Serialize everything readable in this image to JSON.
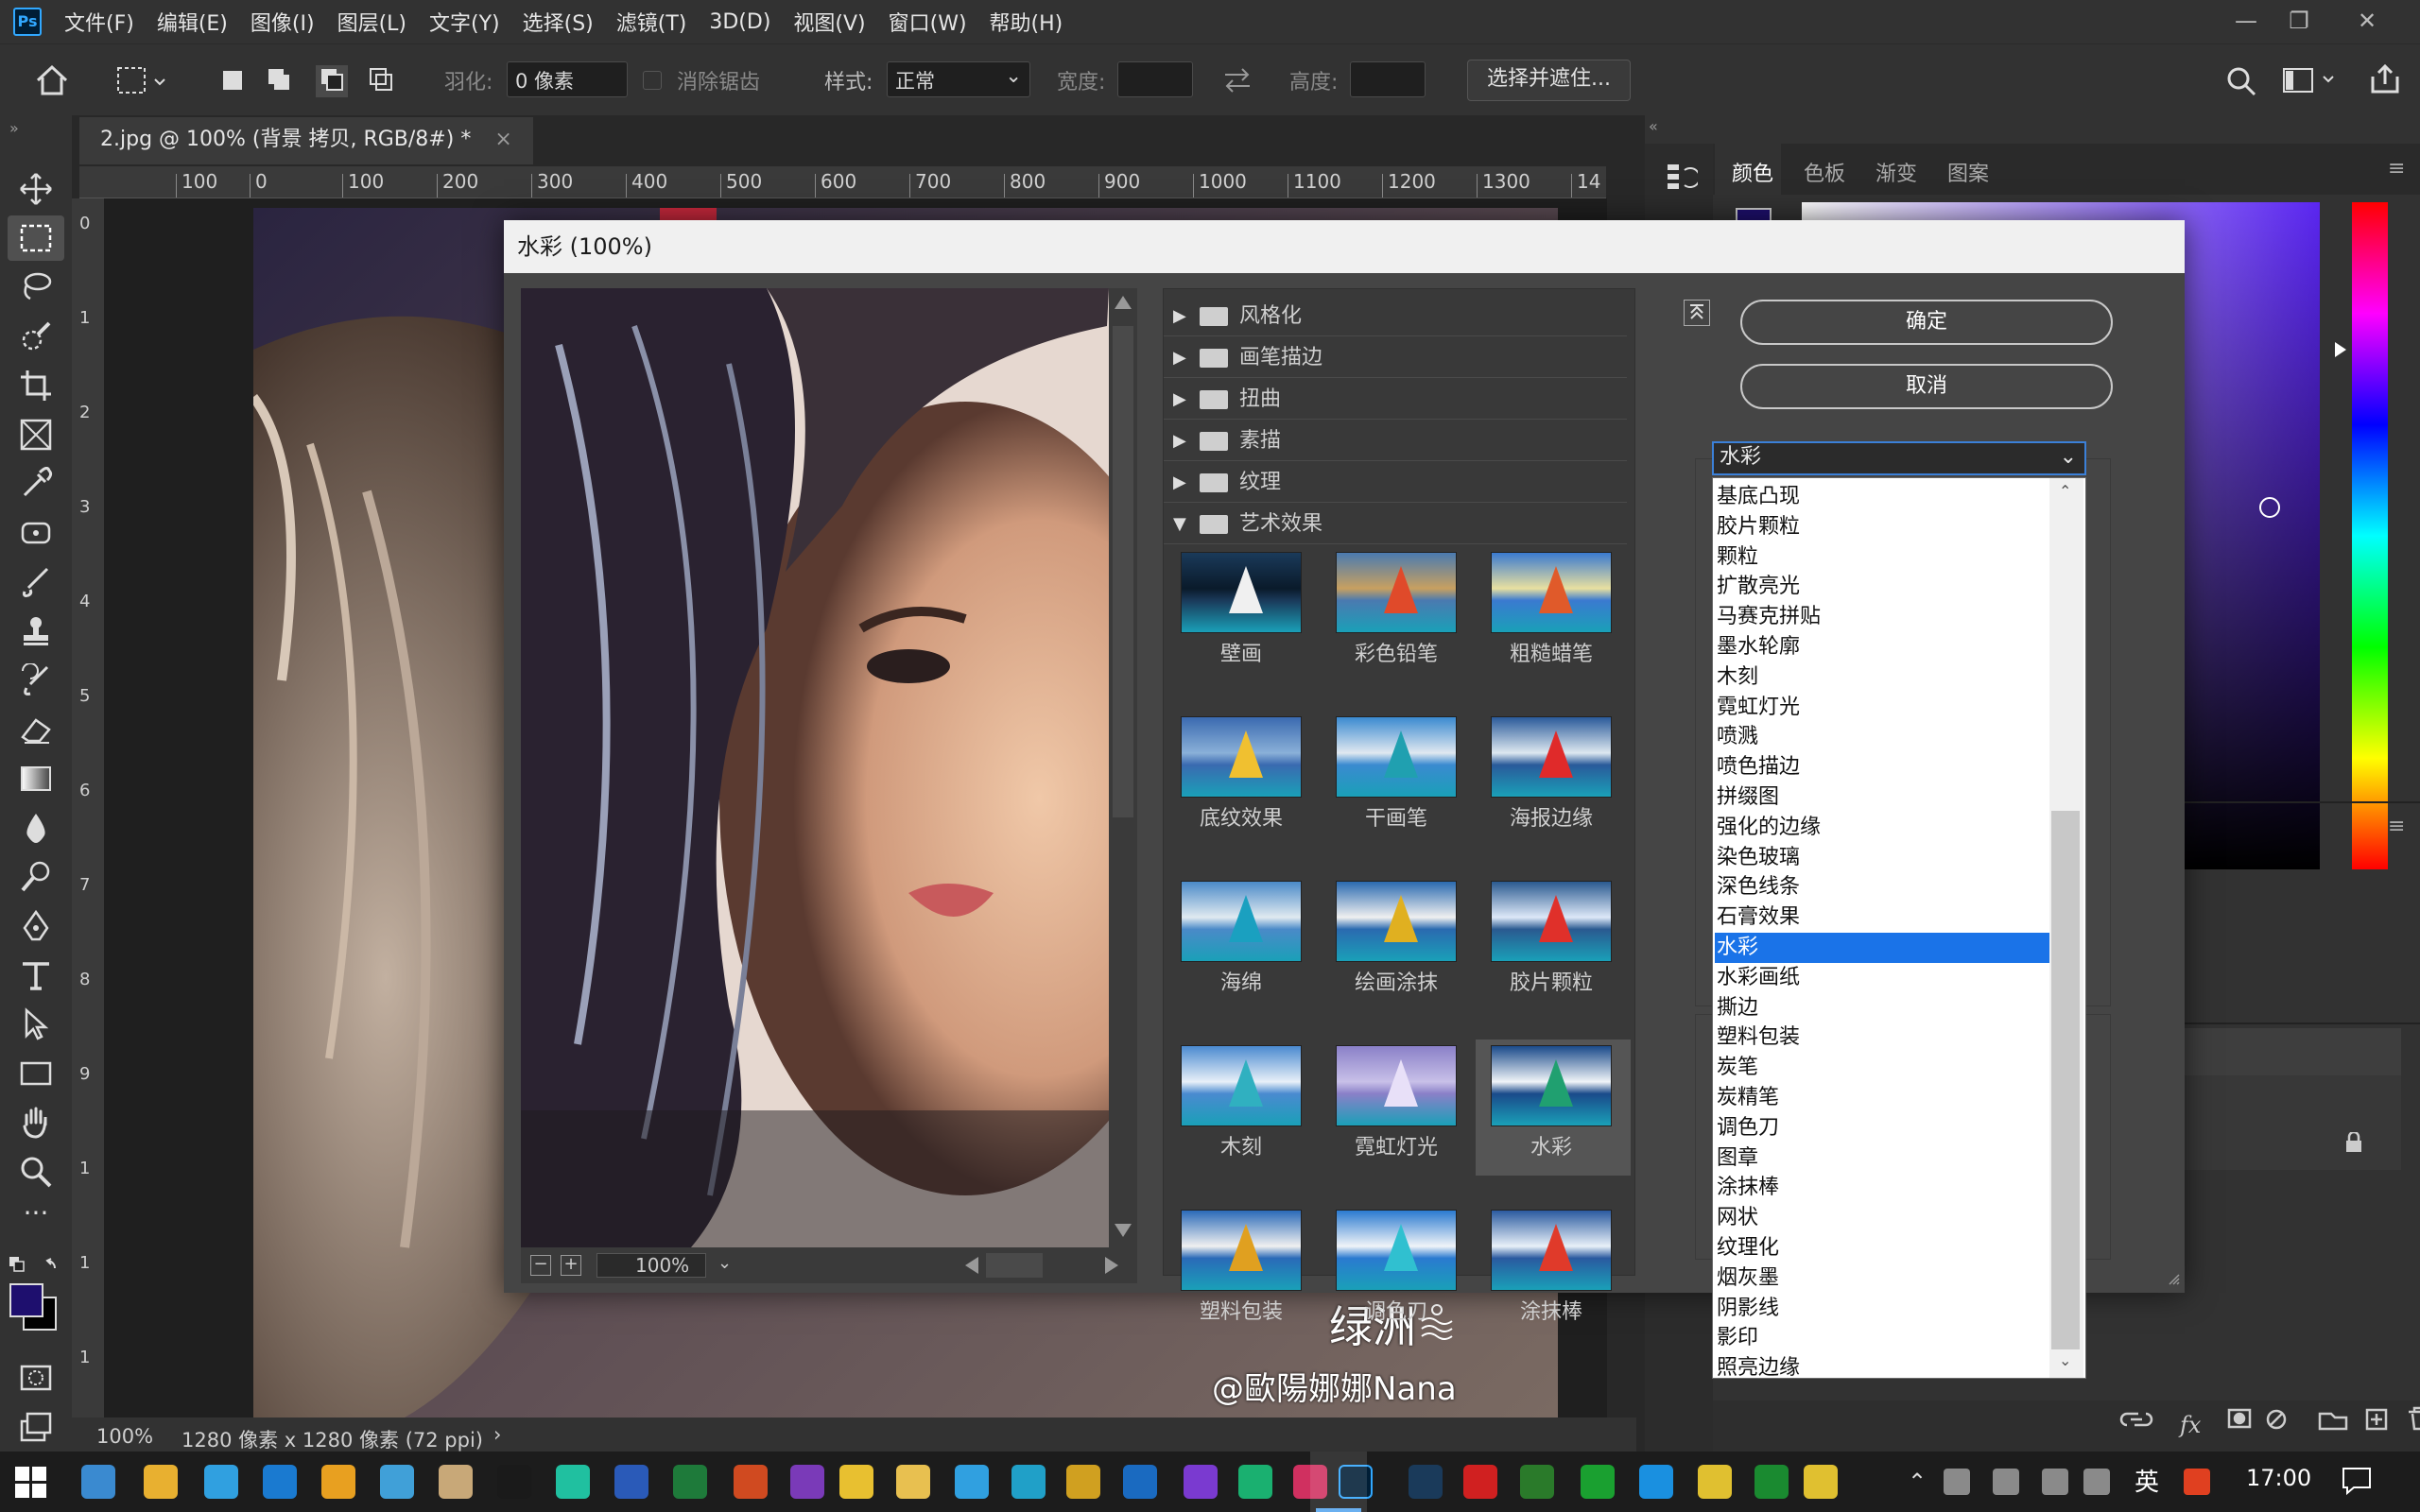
{
  "app": {
    "logo": "Ps"
  },
  "menu": [
    "文件(F)",
    "编辑(E)",
    "图像(I)",
    "图层(L)",
    "文字(Y)",
    "选择(S)",
    "滤镜(T)",
    "3D(D)",
    "视图(V)",
    "窗口(W)",
    "帮助(H)"
  ],
  "window_controls": {
    "minimize": "—",
    "restore": "❐",
    "close": "✕"
  },
  "options": {
    "feather_label": "羽化:",
    "feather_value": "0 像素",
    "antialias_label": "消除锯齿",
    "style_label": "样式:",
    "style_value": "正常",
    "width_label": "宽度:",
    "height_label": "高度:",
    "select_mask_label": "选择并遮住..."
  },
  "document": {
    "tab_title": "2.jpg @ 100% (背景 拷贝, RGB/8#) *",
    "close": "×"
  },
  "ruler": {
    "h_ticks": [
      "100",
      "0",
      "100",
      "200",
      "300",
      "400",
      "500",
      "600",
      "700",
      "800",
      "900",
      "1000",
      "1100",
      "1200",
      "1300",
      "14"
    ],
    "v_ticks": [
      "0",
      "1",
      "2",
      "3",
      "4",
      "5",
      "6",
      "7",
      "8",
      "9",
      "1",
      "1",
      "1"
    ]
  },
  "status": {
    "zoom": "100%",
    "info": "1280 像素 x 1280 像素 (72 ppi)",
    "arrow": "›"
  },
  "panels": {
    "tabs": [
      "颜色",
      "色板",
      "渐变",
      "图案"
    ]
  },
  "watermark": {
    "line1": "绿洲",
    "line2": "@歐陽娜娜Nana"
  },
  "dialog": {
    "title": "水彩 (100%)",
    "ok": "确定",
    "cancel": "取消",
    "zoom": "100%",
    "categories": [
      {
        "label": "风格化",
        "expanded": false
      },
      {
        "label": "画笔描边",
        "expanded": false
      },
      {
        "label": "扭曲",
        "expanded": false
      },
      {
        "label": "素描",
        "expanded": false
      },
      {
        "label": "纹理",
        "expanded": false
      },
      {
        "label": "艺术效果",
        "expanded": true
      }
    ],
    "thumbnails": [
      "壁画",
      "彩色铅笔",
      "粗糙蜡笔",
      "底纹效果",
      "干画笔",
      "海报边缘",
      "海绵",
      "绘画涂抹",
      "胶片颗粒",
      "木刻",
      "霓虹灯光",
      "水彩",
      "塑料包装",
      "调色刀",
      "涂抹棒"
    ],
    "selected_thumbnail": "水彩",
    "dropdown": {
      "value": "水彩",
      "options": [
        "基底凸现",
        "胶片颗粒",
        "颗粒",
        "扩散亮光",
        "马赛克拼贴",
        "墨水轮廓",
        "木刻",
        "霓虹灯光",
        "喷溅",
        "喷色描边",
        "拼缀图",
        "强化的边缘",
        "染色玻璃",
        "深色线条",
        "石膏效果",
        "水彩",
        "水彩画纸",
        "撕边",
        "塑料包装",
        "炭笔",
        "炭精笔",
        "调色刀",
        "图章",
        "涂抹棒",
        "网状",
        "纹理化",
        "烟灰墨",
        "阴影线",
        "影印",
        "照亮边缘"
      ],
      "selected": "水彩"
    }
  },
  "taskbar": {
    "time": "17:00",
    "ime": "英"
  },
  "colors": {
    "foreground": "#1e0f6e",
    "background": "#000000",
    "accent": "#1a73e8"
  }
}
